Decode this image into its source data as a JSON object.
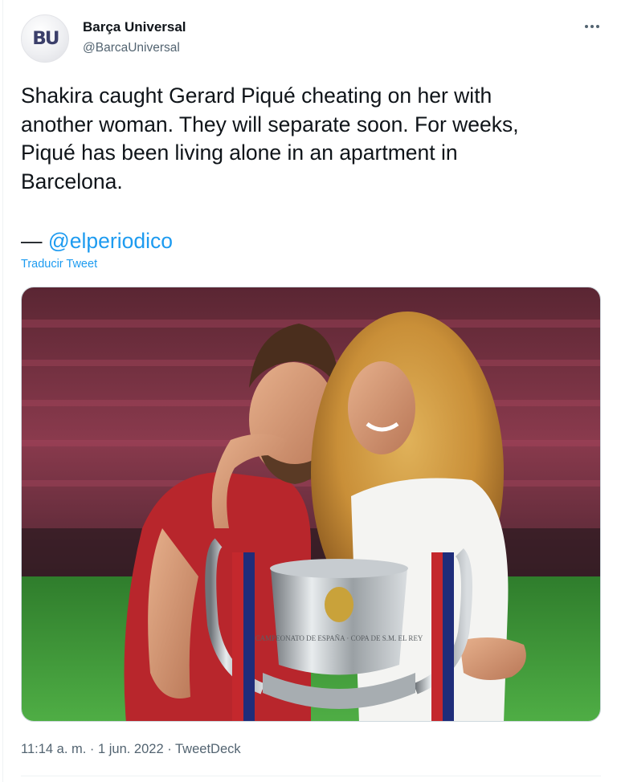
{
  "author": {
    "avatar_text": "BU",
    "display_name": "Barça Universal",
    "handle": "@BarcaUniversal"
  },
  "tweet": {
    "text": "Shakira caught Gerard Piqué cheating on her with\nanother woman. They will separate soon. For weeks,\nPiqué has been living alone in an apartment in\nBarcelona.",
    "source_dash": "— ",
    "source_mention": "@elperiodico",
    "translate_label": "Traducir Tweet"
  },
  "media": {
    "description": "photo",
    "trophy_inscription": "CAMPEONATO DE ESPAÑA · COPA DE S.M. EL REY"
  },
  "meta": {
    "timestamp": "11:14 a. m. · 1 jun. 2022 · TweetDeck"
  },
  "icons": {
    "more": "more-icon"
  },
  "colors": {
    "link": "#1d9bf0",
    "secondary_text": "#536471",
    "primary_text": "#0f1419",
    "pitch_green": "#3f9a3a",
    "jersey_red": "#c4282d"
  }
}
